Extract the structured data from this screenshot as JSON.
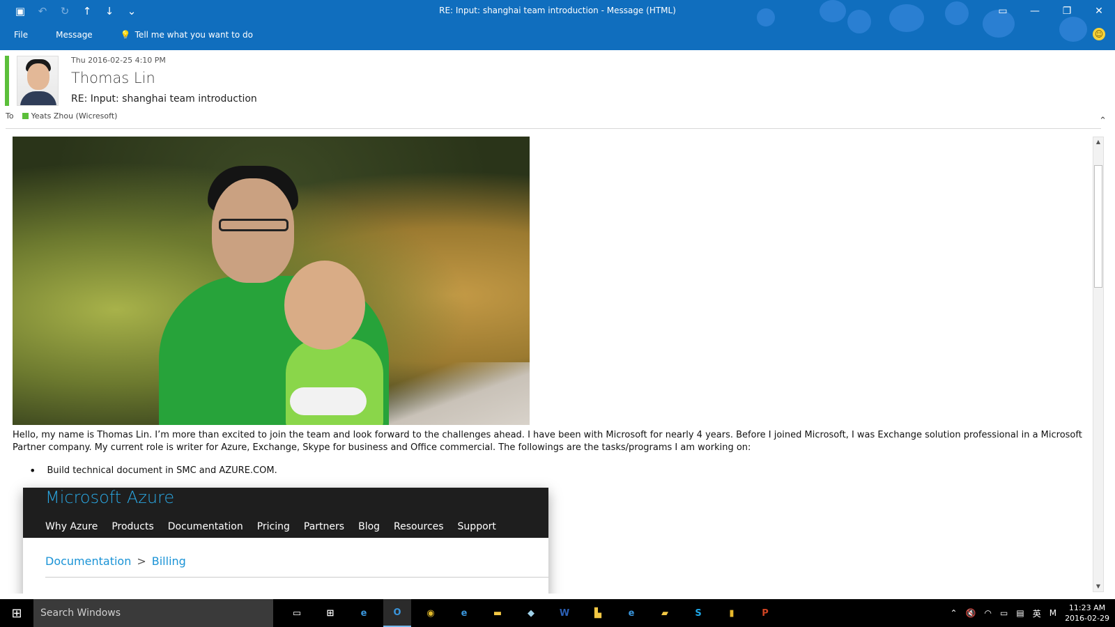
{
  "window": {
    "title": "RE: Input: shanghai team introduction  - Message (HTML)"
  },
  "ribbon": {
    "file": "File",
    "message": "Message",
    "tell_me": "Tell me what you want to do"
  },
  "email": {
    "date": "Thu 2016-02-25 4:10 PM",
    "sender": "Thomas Lin",
    "subject": "RE: Input: shanghai team introduction",
    "to_label": "To",
    "recipient": "Yeats Zhou (Wicresoft)",
    "body": "Hello, my name is Thomas Lin. I’m more than excited to join the team and look forward to the challenges ahead. I have been with Microsoft for nearly 4 years. Before I joined Microsoft, I was Exchange solution professional in a Microsoft Partner company.  My current role is writer for Azure, Exchange, Skype for business and Office commercial.  The followings are the tasks/programs I am working on:",
    "bullets": [
      "Build technical document in SMC and AZURE.COM."
    ]
  },
  "azure": {
    "logo": "Microsoft Azure",
    "nav": [
      "Why Azure",
      "Products",
      "Documentation",
      "Pricing",
      "Partners",
      "Blog",
      "Resources",
      "Support"
    ],
    "crumb_root": "Documentation",
    "crumb_sep": ">",
    "crumb_leaf": "Billing"
  },
  "taskbar": {
    "search": "Search Windows",
    "ime": "英",
    "time": "11:23 AM",
    "date": "2016-02-29"
  },
  "colors": {
    "titlebar": "#106ebe",
    "presence": "#5bbf3a",
    "azure_blue": "#1a93d6"
  }
}
